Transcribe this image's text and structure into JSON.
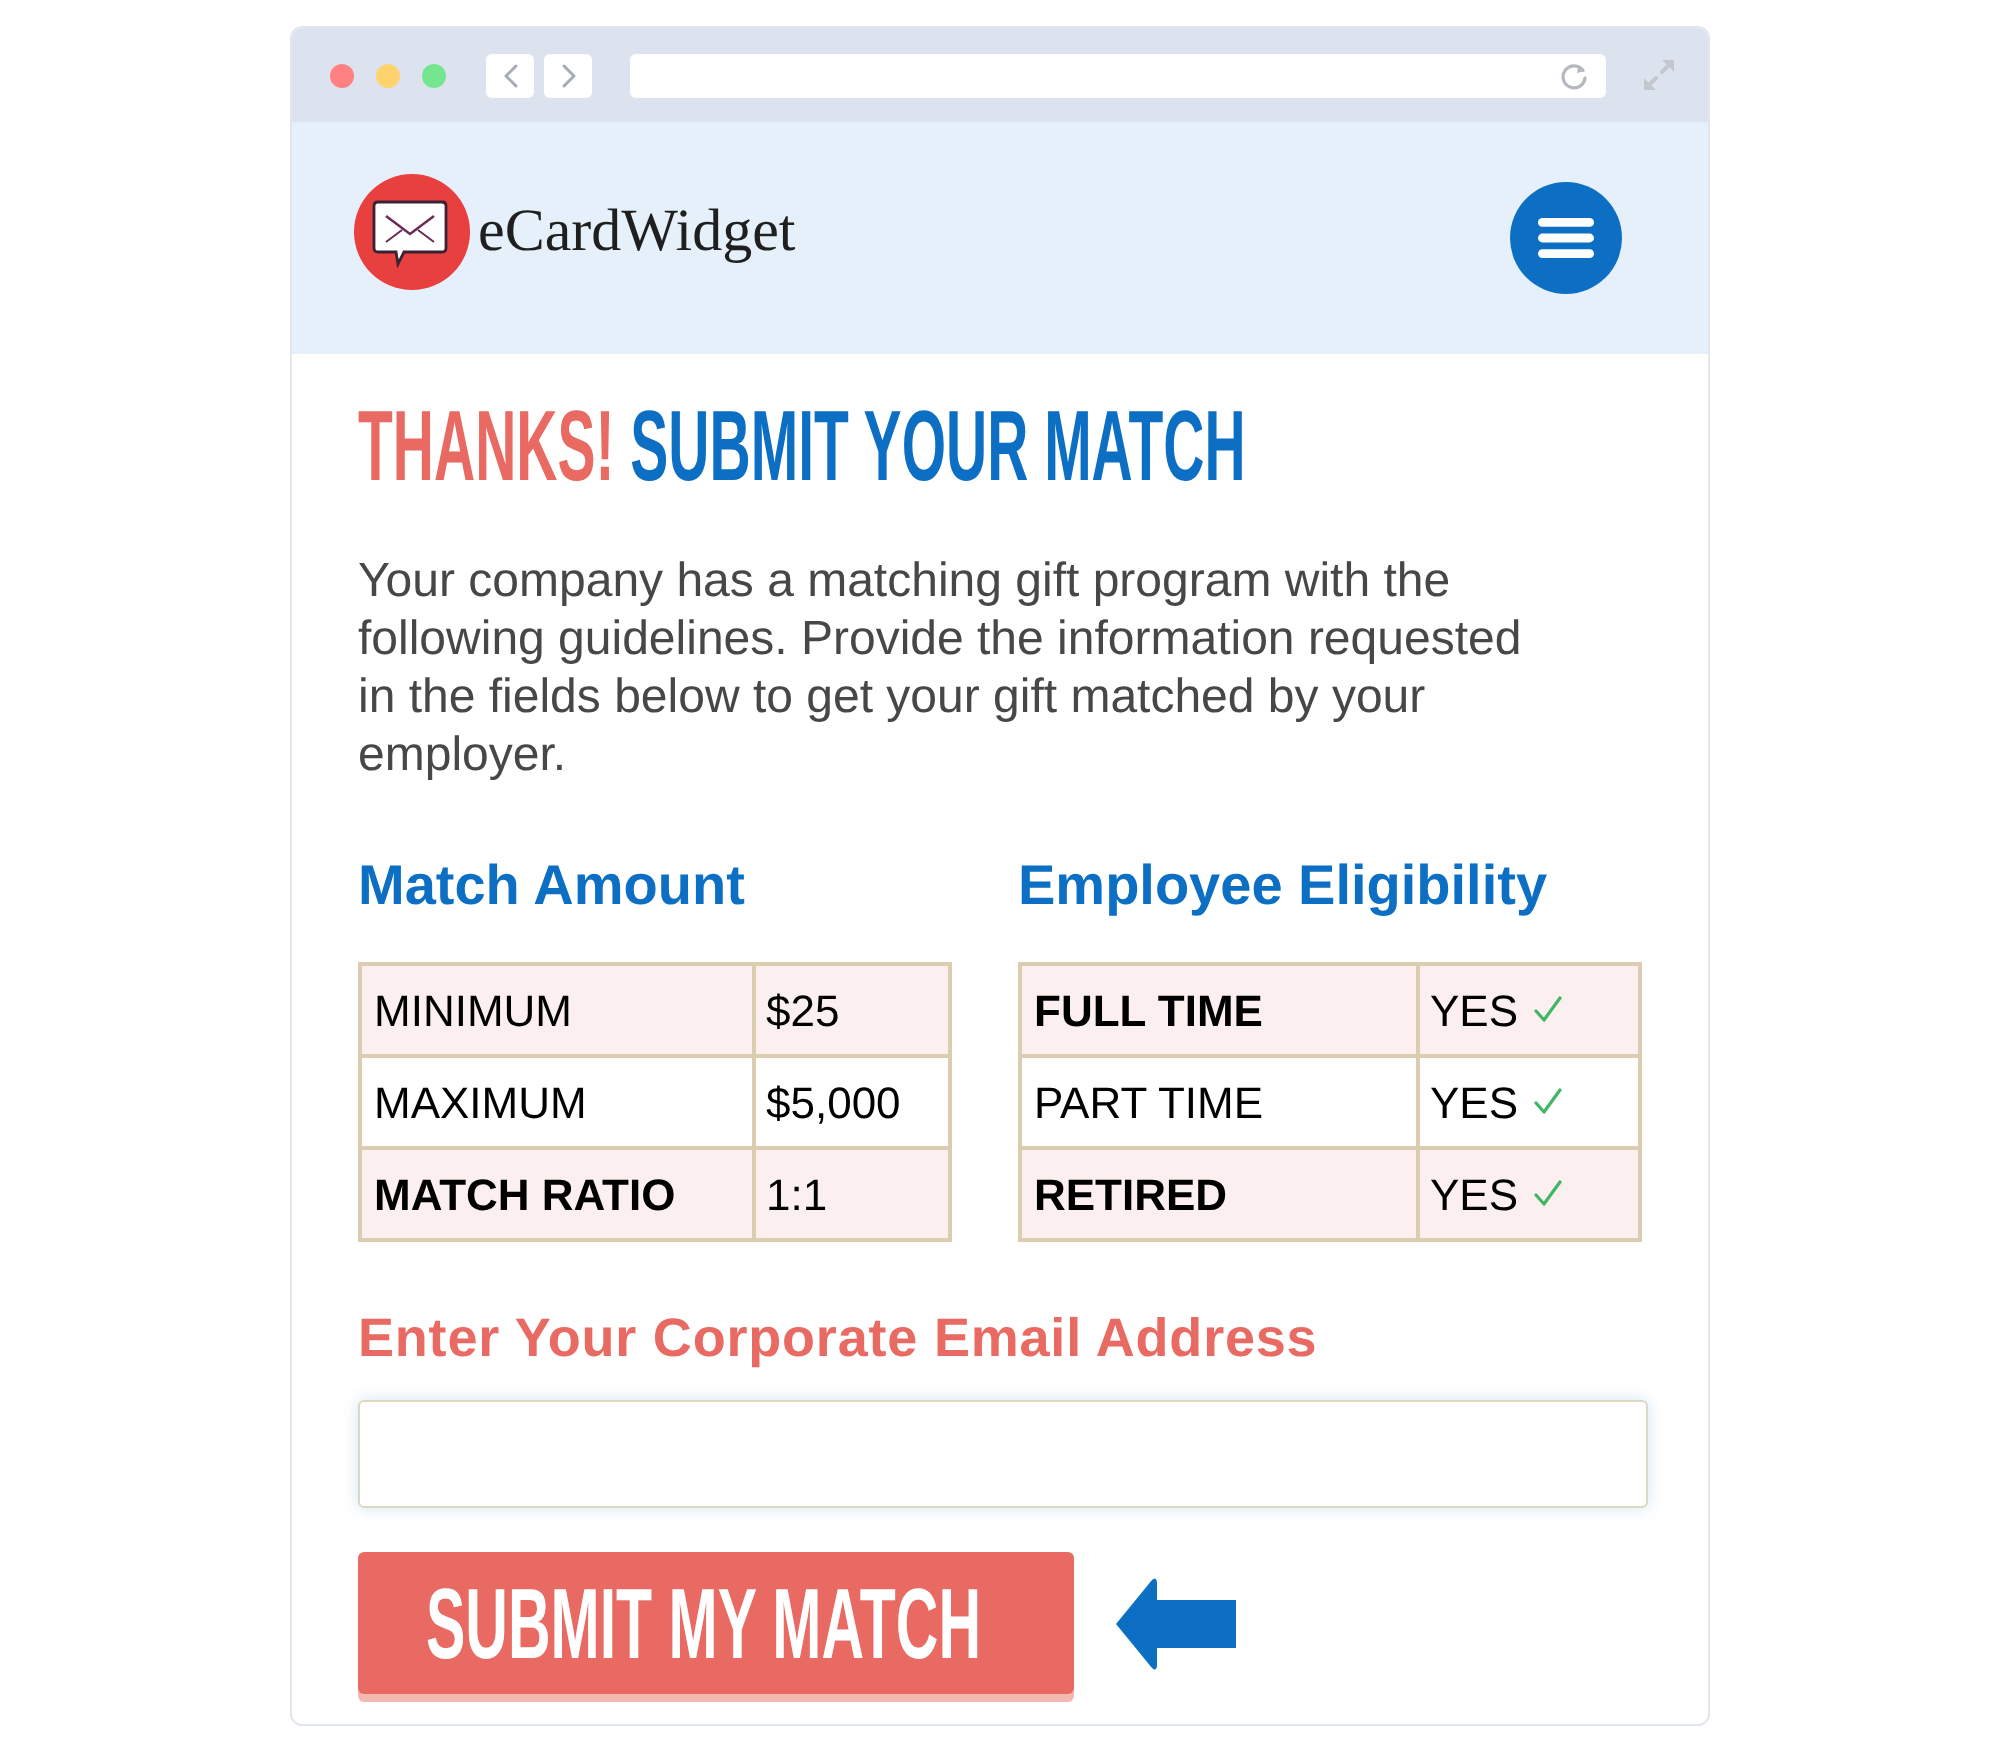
{
  "header": {
    "logo_text": "eCardWidget"
  },
  "title": {
    "accent": "THANKS!",
    "main": "SUBMIT YOUR MATCH"
  },
  "intro": "Your company has a matching gift program with the following guidelines. Provide the information requested in the fields below to get your gift matched by your employer.",
  "tables": [
    {
      "heading": "Match Amount",
      "rows": [
        {
          "label": "MINIMUM",
          "value": "$25",
          "bold": false
        },
        {
          "label": "MAXIMUM",
          "value": "$5,000",
          "bold": false
        },
        {
          "label": "MATCH RATIO",
          "value": "1:1",
          "bold": true
        }
      ]
    },
    {
      "heading": "Employee Eligibility",
      "rows": [
        {
          "label": "FULL TIME",
          "value": "YES",
          "bold": true,
          "check": true
        },
        {
          "label": "PART TIME",
          "value": "YES",
          "bold": false,
          "check": true
        },
        {
          "label": "RETIRED",
          "value": "YES",
          "bold": true,
          "check": true
        }
      ]
    }
  ],
  "email": {
    "label": "Enter Your Corporate Email Address"
  },
  "submit_button": "SUBMIT MY MATCH"
}
